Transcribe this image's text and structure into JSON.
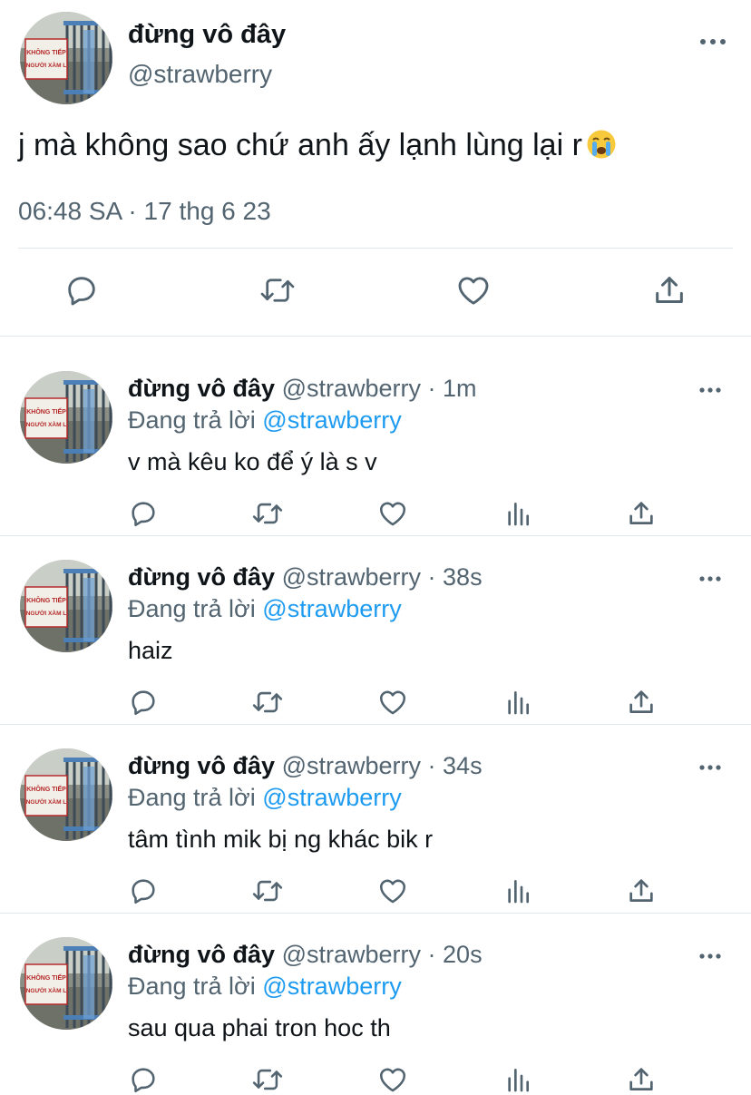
{
  "main_tweet": {
    "display_name": "đừng vô đây",
    "handle": "@strawberry",
    "text": "j mà không sao chứ anh ấy lạnh lùng lại r",
    "emoji": "loudly-crying-face",
    "timestamp": "06:48 SA · 17 thg 6 23",
    "actions": [
      "reply-icon",
      "retweet-icon",
      "like-icon",
      "share-icon"
    ]
  },
  "avatar_sign": {
    "line1": "KHÔNG TIẾP",
    "line2": "NGƯỜI XÀM L"
  },
  "replies": [
    {
      "display_name": "đừng vô đây",
      "handle": "@strawberry",
      "time": "1m",
      "replying_prefix": "Đang trả lời",
      "replying_to": "@strawberry",
      "text": "v mà kêu ko để ý là s v"
    },
    {
      "display_name": "đừng vô đây",
      "handle": "@strawberry",
      "time": "38s",
      "replying_prefix": "Đang trả lời",
      "replying_to": "@strawberry",
      "text": "haiz"
    },
    {
      "display_name": "đừng vô đây",
      "handle": "@strawberry",
      "time": "34s",
      "replying_prefix": "Đang trả lời",
      "replying_to": "@strawberry",
      "text": "tâm tình mik bị ng khác bik r"
    },
    {
      "display_name": "đừng vô đây",
      "handle": "@strawberry",
      "time": "20s",
      "replying_prefix": "Đang trả lời",
      "replying_to": "@strawberry",
      "text": "sau qua phai tron hoc th"
    }
  ],
  "colors": {
    "text": "#0f1419",
    "secondary": "#536471",
    "link": "#1d9bf0",
    "divider": "#e1e8ed"
  }
}
